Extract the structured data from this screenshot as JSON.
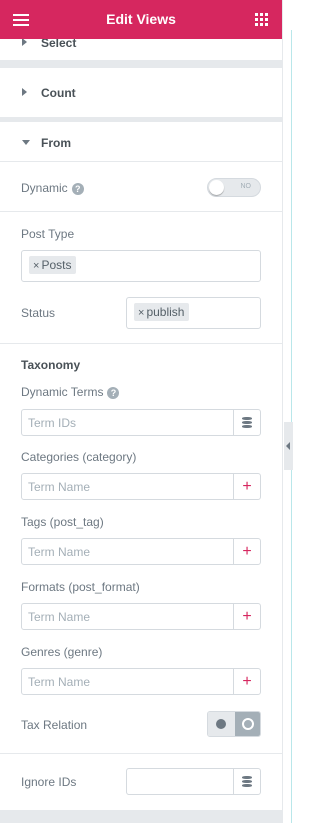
{
  "header": {
    "title": "Edit Views",
    "menu_icon": "hamburger-icon",
    "apps_icon": "grid-icon",
    "color": "#d6275f"
  },
  "sections": {
    "select": "Select",
    "count": "Count",
    "from": "From"
  },
  "from": {
    "dynamic": {
      "label": "Dynamic",
      "help": "?",
      "toggle_text": "NO",
      "checked": false
    },
    "post_type": {
      "label": "Post Type",
      "chips": [
        "Posts"
      ]
    },
    "status": {
      "label": "Status",
      "chips": [
        "publish"
      ]
    },
    "taxonomy_title": "Taxonomy",
    "dynamic_terms": {
      "label": "Dynamic Terms",
      "help": "?",
      "placeholder": "Term IDs"
    },
    "categories": {
      "label": "Categories (category)",
      "placeholder": "Term Name",
      "button": "+"
    },
    "tags": {
      "label": "Tags (post_tag)",
      "placeholder": "Term Name",
      "button": "+"
    },
    "formats": {
      "label": "Formats (post_format)",
      "placeholder": "Term Name",
      "button": "+"
    },
    "genres": {
      "label": "Genres (genre)",
      "placeholder": "Term Name",
      "button": "+"
    },
    "tax_relation": {
      "label": "Tax Relation",
      "selected": "AND"
    },
    "ignore_ids": {
      "label": "Ignore IDs",
      "value": ""
    }
  },
  "chip_remove": "×"
}
